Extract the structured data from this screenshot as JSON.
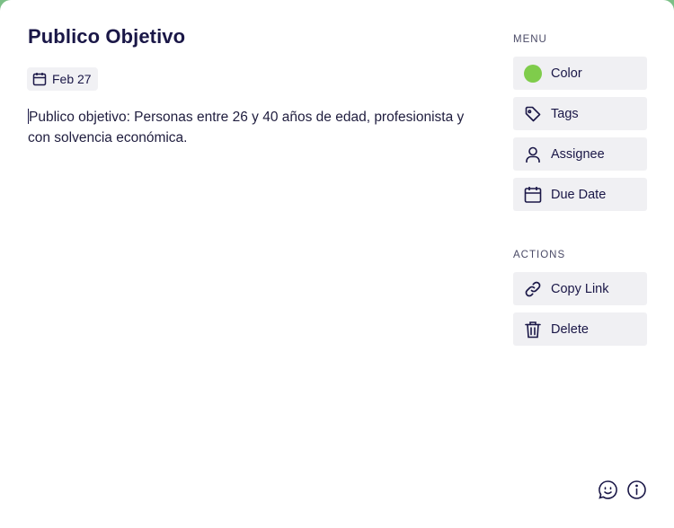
{
  "card": {
    "title": "Publico Objetivo",
    "due_date": "Feb 27",
    "description": "Publico objetivo: Personas entre 26 y 40 años de edad, profesionista y con solvencia económica."
  },
  "menu": {
    "label": "MENU",
    "items": [
      {
        "label": "Color",
        "icon": "color-dot-icon",
        "color": "#7fcc4b"
      },
      {
        "label": "Tags",
        "icon": "tag-icon"
      },
      {
        "label": "Assignee",
        "icon": "user-icon"
      },
      {
        "label": "Due Date",
        "icon": "calendar-icon"
      }
    ]
  },
  "actions": {
    "label": "ACTIONS",
    "items": [
      {
        "label": "Copy Link",
        "icon": "link-icon"
      },
      {
        "label": "Delete",
        "icon": "trash-icon"
      }
    ]
  },
  "footer": {
    "icons": [
      "feedback-icon",
      "info-icon"
    ]
  },
  "colors": {
    "text_primary": "#1a1747",
    "button_bg": "#f0f0f3",
    "accent_green": "#7fcc4b"
  }
}
